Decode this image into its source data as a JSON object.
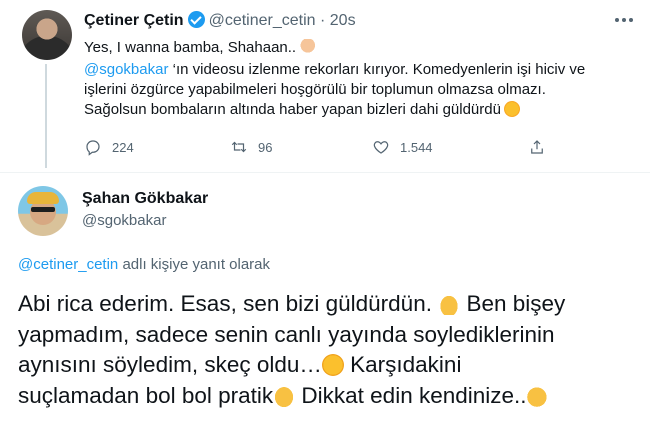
{
  "tweet": {
    "author_name": "Çetiner Çetin",
    "author_handle": "@cetiner_cetin",
    "separator": "·",
    "time": "20s",
    "line1": "Yes, I wanna bamba, Shahaan..",
    "mention": "@sgokbakar",
    "line2_rest": " ‘ın videosu izlenme rekorları kırıyor. Komedyenlerin işi hiciv ve",
    "line3": "işlerini özgürce yapabilmeleri hoşgörülü bir toplumun olmazsa olmazı.",
    "line4": "Sağolsun bombaların altında haber yapan bizleri dahi güldürdü",
    "replies": "224",
    "retweets": "96",
    "likes": "1.544"
  },
  "reply": {
    "author_name": "Şahan Gökbakar",
    "author_handle": "@sgokbakar",
    "replying_mention": "@cetiner_cetin",
    "replying_text": " adlı kişiye yanıt olarak",
    "line1_a": "Abi rica ederim. Esas, sen bizi güldürdün. ",
    "line1_b": " Ben bişey",
    "line2": "yapmadım, sadece senin canlı yayında soylediklerinin",
    "line3_a": "aynısını söyledim, skeç oldu…",
    "line3_b": " Karşıdakini",
    "line4_a": "suçlamadan bol bol pratik",
    "line4_b": " Dikkat edin kendinize..",
    "emojis": [
      "folded-hands-emoji",
      "tears-of-joy-emoji",
      "thumbs-up-emoji",
      "waving-hand-emoji"
    ]
  },
  "colors": {
    "link": "#1d9bf0",
    "secondary_text": "#536471",
    "primary_text": "#0f1419",
    "divider": "#eff3f4"
  }
}
